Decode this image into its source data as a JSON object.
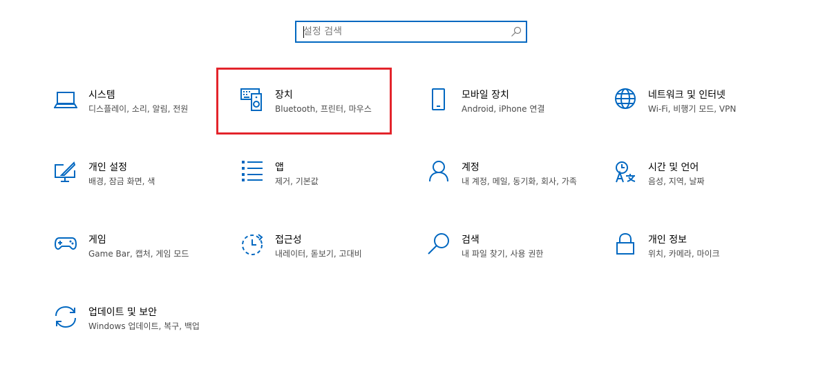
{
  "search": {
    "placeholder": "설정 검색",
    "icon": "search-icon"
  },
  "accent_color": "#0067c0",
  "highlight_color": "#e3242b",
  "categories": [
    {
      "title": "시스템",
      "desc": "디스플레이, 소리, 알림, 전원",
      "icon": "laptop-icon"
    },
    {
      "title": "장치",
      "desc": "Bluetooth, 프린터, 마우스",
      "icon": "devices-icon",
      "highlighted": true
    },
    {
      "title": "모바일 장치",
      "desc": "Android, iPhone 연결",
      "icon": "phone-icon"
    },
    {
      "title": "네트워크 및 인터넷",
      "desc": "Wi-Fi, 비행기 모드, VPN",
      "icon": "globe-icon"
    },
    {
      "title": "개인 설정",
      "desc": "배경, 잠금 화면, 색",
      "icon": "personalization-icon"
    },
    {
      "title": "앱",
      "desc": "제거, 기본값",
      "icon": "apps-list-icon"
    },
    {
      "title": "계정",
      "desc": "내 계정, 메일, 동기화, 회사, 가족",
      "icon": "person-icon"
    },
    {
      "title": "시간 및 언어",
      "desc": "음성, 지역, 날짜",
      "icon": "time-language-icon"
    },
    {
      "title": "게임",
      "desc": "Game Bar, 캡처, 게임 모드",
      "icon": "gamepad-icon"
    },
    {
      "title": "접근성",
      "desc": "내레이터, 돋보기, 고대비",
      "icon": "accessibility-icon"
    },
    {
      "title": "검색",
      "desc": "내 파일 찾기, 사용 권한",
      "icon": "magnifier-icon"
    },
    {
      "title": "개인 정보",
      "desc": "위치, 카메라, 마이크",
      "icon": "lock-icon"
    },
    {
      "title": "업데이트 및 보안",
      "desc": "Windows 업데이트, 복구, 백업",
      "icon": "sync-icon"
    }
  ]
}
